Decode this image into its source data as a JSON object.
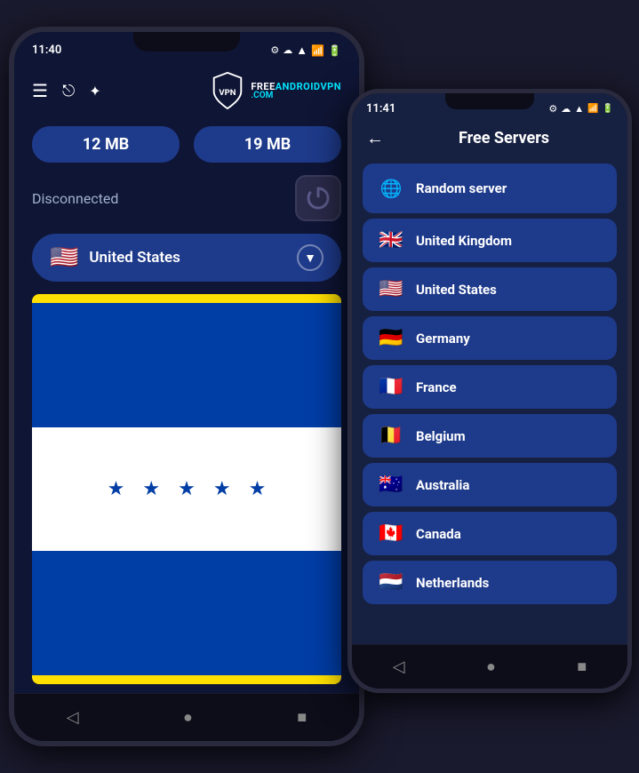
{
  "phone1": {
    "status_bar": {
      "time": "11:40",
      "icons": [
        "⚙",
        "☁"
      ]
    },
    "toolbar": {
      "list_icon": "≡",
      "share_icon": "⎋",
      "star_icon": "✦",
      "logo_text_top": "FREE",
      "logo_text_colored": "ANDROIDVPN",
      "logo_text_bottom": ".COM"
    },
    "stats": {
      "download": "12 MB",
      "upload": "19 MB"
    },
    "connection": {
      "status": "Disconnected"
    },
    "country": {
      "name": "United States",
      "flag": "🇺🇸"
    },
    "nav": [
      "◁",
      "●",
      "■"
    ]
  },
  "phone2": {
    "status_bar": {
      "time": "11:41",
      "icons": [
        "⚙",
        "☁"
      ]
    },
    "header": {
      "back": "←",
      "title": "Free Servers"
    },
    "servers": [
      {
        "name": "Random server",
        "flag": "🌐",
        "type": "globe"
      },
      {
        "name": "United Kingdom",
        "flag": "🇬🇧",
        "type": "flag"
      },
      {
        "name": "United States",
        "flag": "🇺🇸",
        "type": "flag"
      },
      {
        "name": "Germany",
        "flag": "🇩🇪",
        "type": "flag"
      },
      {
        "name": "France",
        "flag": "🇫🇷",
        "type": "flag"
      },
      {
        "name": "Belgium",
        "flag": "🇧🇪",
        "type": "flag"
      },
      {
        "name": "Australia",
        "flag": "🇦🇺",
        "type": "flag"
      },
      {
        "name": "Canada",
        "flag": "🇨🇦",
        "type": "flag"
      },
      {
        "name": "Netherlands",
        "flag": "🇳🇱",
        "type": "flag"
      }
    ],
    "nav": [
      "◁",
      "●",
      "■"
    ]
  }
}
